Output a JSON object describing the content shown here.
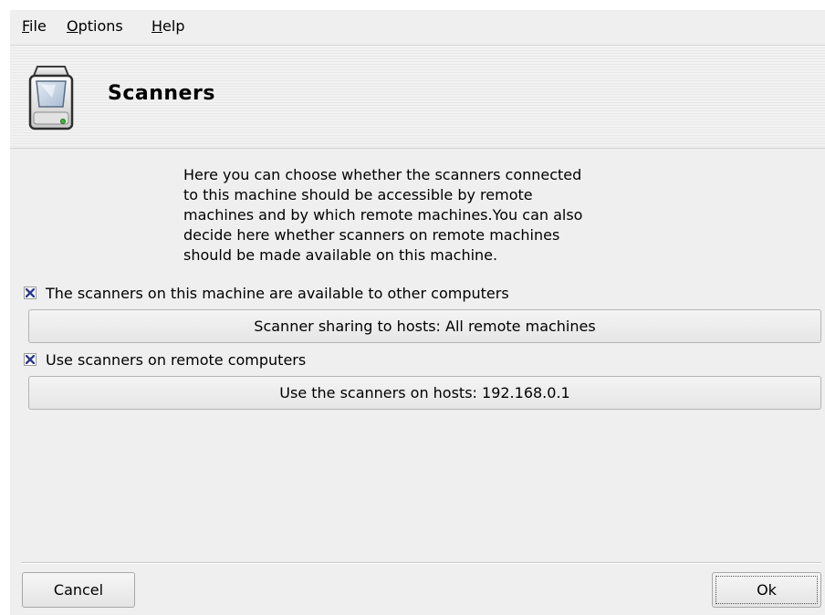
{
  "menubar": {
    "items": [
      {
        "mnemonic": "F",
        "rest": "ile"
      },
      {
        "mnemonic": "O",
        "rest": "ptions"
      },
      {
        "mnemonic": "H",
        "rest": "elp"
      }
    ]
  },
  "header": {
    "title": "Scanners",
    "icon": "scanner-icon"
  },
  "description": [
    "Here you can choose whether the scanners connected",
    "to this machine should be accessible by remote",
    "machines and by which remote machines.You can also",
    "decide here whether scanners on remote machines",
    "should be made available on this machine."
  ],
  "sharing": {
    "checkbox_label": "The scanners on this machine are available to other computers",
    "checked": true,
    "button_label": "Scanner sharing to hosts: All remote machines"
  },
  "remote": {
    "checkbox_label": "Use scanners on remote computers",
    "checked": true,
    "button_label": "Use the scanners on hosts: 192.168.0.1"
  },
  "buttons": {
    "cancel": "Cancel",
    "ok": "Ok"
  },
  "colors": {
    "check_mark": "#2b3a8c",
    "window_bg": "#efefef"
  }
}
